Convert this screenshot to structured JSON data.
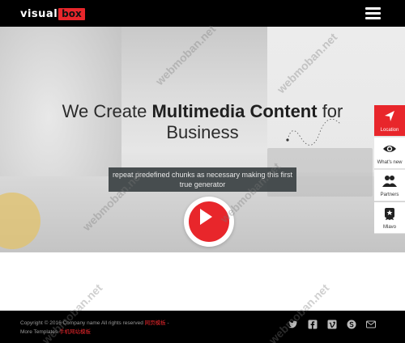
{
  "header": {
    "logo_part1": "visual",
    "logo_part2": "box",
    "menu_icon": "hamburger-menu-icon"
  },
  "hero": {
    "title_part1": "We Create ",
    "title_bold": "Multimedia Content",
    "title_part2": " for",
    "title_line2": "Business",
    "caption": "repeat predefined chunks as necessary making this first true generator",
    "play_icon": "play-icon"
  },
  "side_nav": {
    "items": [
      {
        "label": "Location",
        "icon": "location-arrow-icon",
        "active": true
      },
      {
        "label": "What's new",
        "icon": "eye-icon",
        "active": false
      },
      {
        "label": "Partners",
        "icon": "users-icon",
        "active": false
      },
      {
        "label": "Mlavo",
        "icon": "award-icon",
        "active": false
      }
    ]
  },
  "footer": {
    "copyright_prefix": "Copyright © 2016 Company name All rights reserved ",
    "copyright_link": "网页模板",
    "copyright_suffix": " -",
    "more_prefix": "More Templates ",
    "more_link": "手机网站模板",
    "social": [
      "twitter-icon",
      "facebook-icon",
      "vimeo-icon",
      "skype-icon",
      "mail-icon"
    ]
  },
  "watermark": "webmoban.net",
  "colors": {
    "accent": "#e8262b",
    "dark": "#000000"
  }
}
